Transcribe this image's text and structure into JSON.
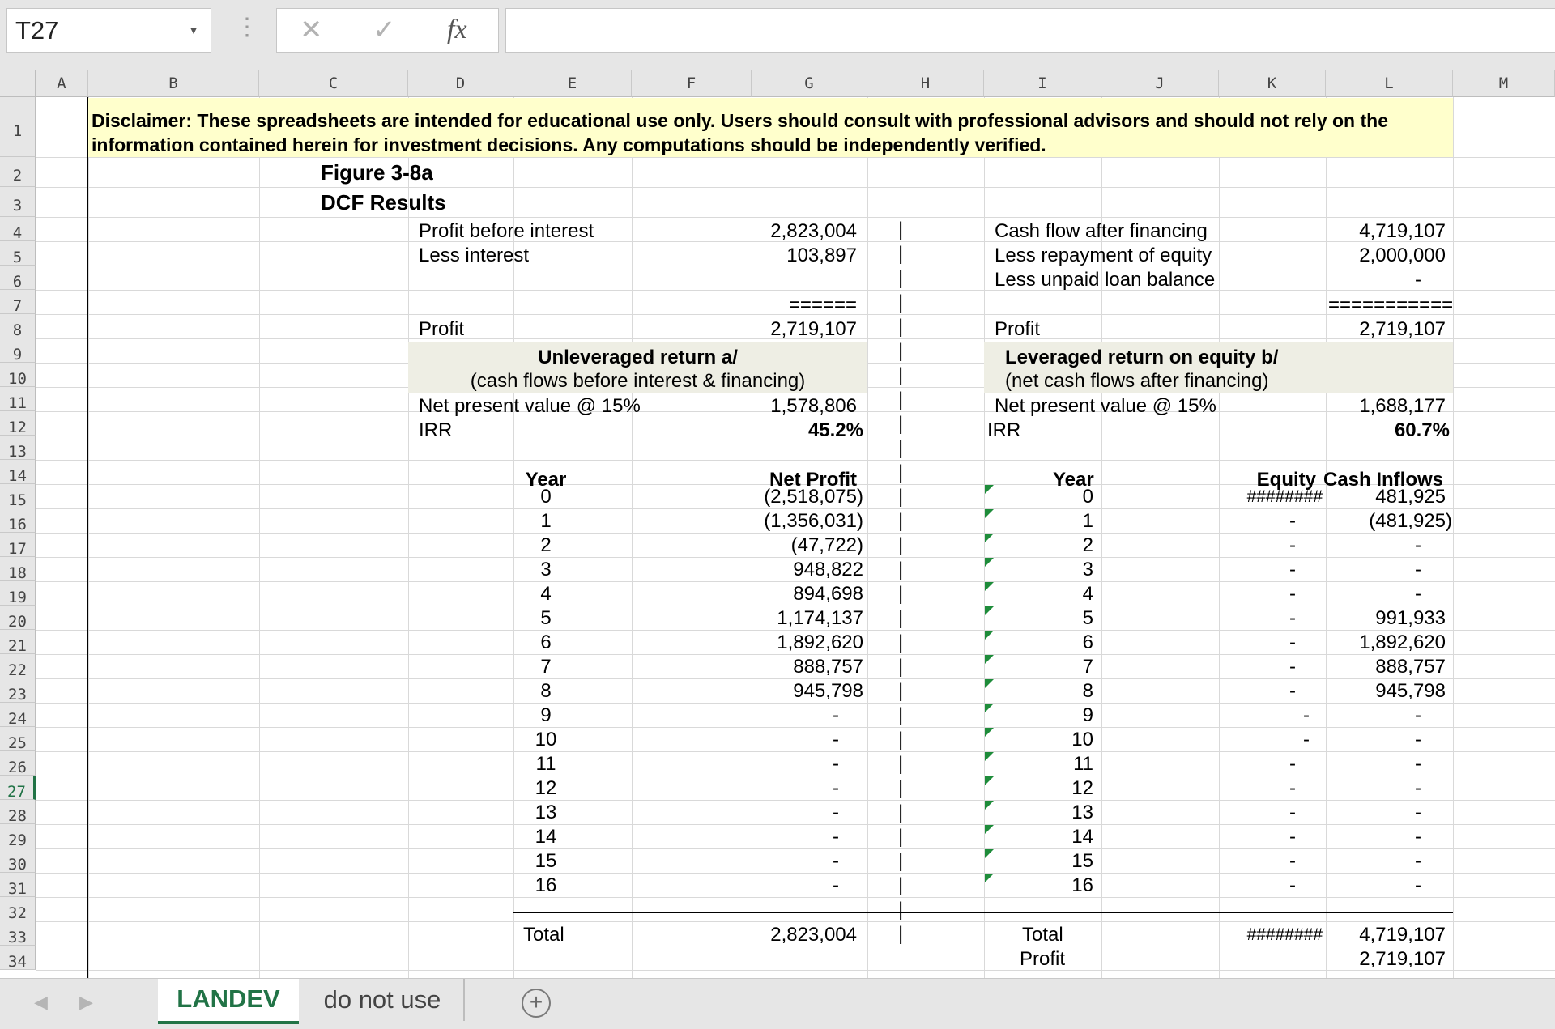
{
  "formula_bar": {
    "name_box": "T27",
    "cancel_glyph": "✕",
    "enter_glyph": "✓",
    "fx_label": "fx",
    "formula": ""
  },
  "columns": [
    "A",
    "B",
    "C",
    "D",
    "E",
    "F",
    "G",
    "H",
    "I",
    "J",
    "K",
    "L",
    "M"
  ],
  "rows": [
    "1",
    "2",
    "3",
    "4",
    "5",
    "6",
    "7",
    "8",
    "9",
    "10",
    "11",
    "12",
    "13",
    "14",
    "15",
    "16",
    "17",
    "18",
    "19",
    "20",
    "21",
    "22",
    "23",
    "24",
    "25",
    "26",
    "27",
    "28",
    "29",
    "30",
    "31",
    "32",
    "33",
    "34"
  ],
  "selected_row": "27",
  "disclaimer": "Disclaimer: These spreadsheets are intended for educational use only. Users should consult with professional advisors and should not rely on the information contained herein for investment decisions. Any computations should be independently verified.",
  "figure_title": "Figure 3-8a",
  "section_title": "DCF Results",
  "left_summary": {
    "profit_before_interest_label": "Profit before interest",
    "profit_before_interest": "2,823,004",
    "less_interest_label": "Less interest",
    "less_interest": "103,897",
    "separator": "======",
    "profit_label": "Profit",
    "profit": "2,719,107"
  },
  "right_summary": {
    "cash_flow_label": "Cash flow after financing",
    "cash_flow": "4,719,107",
    "repayment_label": "Less repayment of equity",
    "repayment": "2,000,000",
    "unpaid_label": "Less unpaid loan balance",
    "unpaid": "-",
    "separator": "===========",
    "profit_label": "Profit",
    "profit": "2,719,107"
  },
  "unleveraged": {
    "title": "Unleveraged return a/",
    "subtitle": "(cash flows before interest & financing)",
    "npv_label": "Net present value @ 15%",
    "npv": "1,578,806",
    "irr_label": "IRR",
    "irr": "45.2%"
  },
  "leveraged": {
    "title": "Leveraged return on equity b/",
    "subtitle": "(net cash flows after financing)",
    "npv_label": "Net present value @ 15%",
    "npv": "1,688,177",
    "irr_label": "IRR",
    "irr": "60.7%"
  },
  "divider_glyph": "|",
  "left_table": {
    "year_header": "Year",
    "value_header": "Net Profit",
    "rows": [
      {
        "year": "0",
        "value": "(2,518,075)"
      },
      {
        "year": "1",
        "value": "(1,356,031)"
      },
      {
        "year": "2",
        "value": "(47,722)"
      },
      {
        "year": "3",
        "value": "948,822"
      },
      {
        "year": "4",
        "value": "894,698"
      },
      {
        "year": "5",
        "value": "1,174,137"
      },
      {
        "year": "6",
        "value": "1,892,620"
      },
      {
        "year": "7",
        "value": "888,757"
      },
      {
        "year": "8",
        "value": "945,798"
      },
      {
        "year": "9",
        "value": "-"
      },
      {
        "year": "10",
        "value": "-"
      },
      {
        "year": "11",
        "value": "-"
      },
      {
        "year": "12",
        "value": "-"
      },
      {
        "year": "13",
        "value": "-"
      },
      {
        "year": "14",
        "value": "-"
      },
      {
        "year": "15",
        "value": "-"
      },
      {
        "year": "16",
        "value": "-"
      }
    ],
    "total_label": "Total",
    "total": "2,823,004"
  },
  "right_table": {
    "year_header": "Year",
    "equity_header": "Equity",
    "inflows_header": "Cash Inflows",
    "rows": [
      {
        "year": "0",
        "equity": "########",
        "inflow": "481,925"
      },
      {
        "year": "1",
        "equity": "-",
        "inflow": "(481,925)"
      },
      {
        "year": "2",
        "equity": "-",
        "inflow": "-"
      },
      {
        "year": "3",
        "equity": "-",
        "inflow": "-"
      },
      {
        "year": "4",
        "equity": "-",
        "inflow": "-"
      },
      {
        "year": "5",
        "equity": "-",
        "inflow": "991,933"
      },
      {
        "year": "6",
        "equity": "-",
        "inflow": "1,892,620"
      },
      {
        "year": "7",
        "equity": "-",
        "inflow": "888,757"
      },
      {
        "year": "8",
        "equity": "-",
        "inflow": "945,798"
      },
      {
        "year": "9",
        "equity": "-",
        "inflow": "-"
      },
      {
        "year": "10",
        "equity": "-",
        "inflow": "-"
      },
      {
        "year": "11",
        "equity": "-",
        "inflow": "-"
      },
      {
        "year": "12",
        "equity": "-",
        "inflow": "-"
      },
      {
        "year": "13",
        "equity": "-",
        "inflow": "-"
      },
      {
        "year": "14",
        "equity": "-",
        "inflow": "-"
      },
      {
        "year": "15",
        "equity": "-",
        "inflow": "-"
      },
      {
        "year": "16",
        "equity": "-",
        "inflow": "-"
      }
    ],
    "total_label": "Total",
    "total_equity": "########",
    "total_inflows": "4,719,107",
    "profit_label": "Profit",
    "profit": "2,719,107"
  },
  "sheet_tabs": {
    "prev_glyph": "◀",
    "next_glyph": "▶",
    "active": "LANDEV",
    "other": "do not use",
    "add_glyph": "+"
  }
}
